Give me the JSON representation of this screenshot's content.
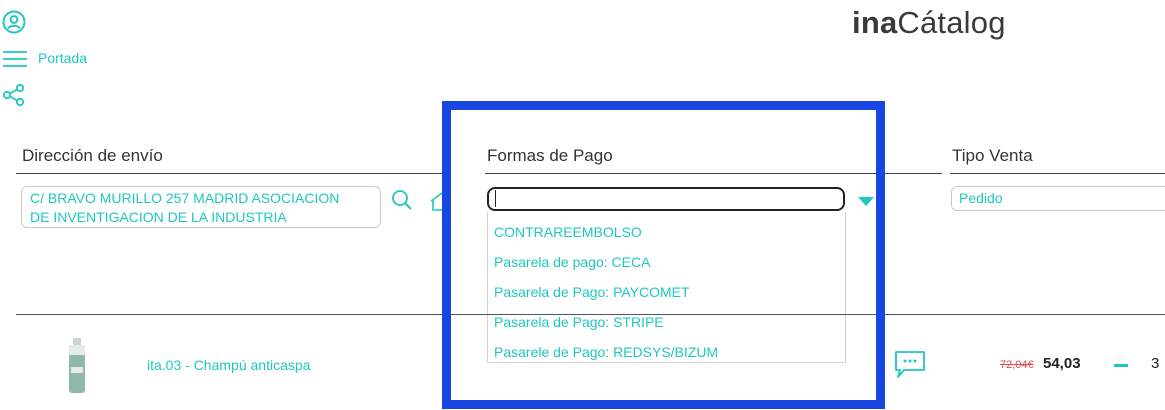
{
  "header": {
    "nav_label": "Portada",
    "logo_bold": "ina",
    "logo_regular": "Cátalog",
    "icons": [
      "user-icon",
      "menu-icon",
      "share-icon"
    ]
  },
  "shipping": {
    "title": "Dirección de envío",
    "address_line1": "C/ BRAVO MURILLO 257 MADRID ASOCIACION",
    "address_line2": "DE INVENTIGACION DE LA INDUSTRIA",
    "icons": [
      "search-icon",
      "home-icon"
    ]
  },
  "payment": {
    "title": "Formas de Pago",
    "value": "",
    "options": [
      "CONTRAREEMBOLSO",
      "Pasarela de pago: CECA",
      "Pasarela de Pago: PAYCOMET",
      "Pasarela de Pago: STRIPE",
      "Pasarele de Pago: REDSYS/BIZUM"
    ]
  },
  "sale_type": {
    "title": "Tipo Venta",
    "value": "Pedido"
  },
  "product": {
    "name": "ita.03 - Champú anticaspa",
    "old_price": "72,04€",
    "price": "54,03",
    "quantity": "3",
    "icons": [
      "product-image",
      "comment-icon",
      "minus-icon"
    ]
  },
  "colors": {
    "accent": "#1fc7c0",
    "highlight": "#1746e0",
    "old_price": "#e04a4a"
  }
}
